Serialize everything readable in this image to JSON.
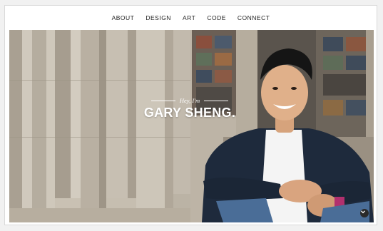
{
  "nav": {
    "items": [
      {
        "label": "ABOUT"
      },
      {
        "label": "DESIGN"
      },
      {
        "label": "ART"
      },
      {
        "label": "CODE"
      },
      {
        "label": "CONNECT"
      }
    ]
  },
  "hero": {
    "greeting": "Hey, I'm",
    "name": "GARY SHENG."
  },
  "icons": {
    "scroll_down": "chevron-down-icon"
  },
  "colors": {
    "background": "#f1f1f1",
    "nav_text": "#222222",
    "hero_text": "#ffffff",
    "scroll_button": "#2a2a2a"
  }
}
